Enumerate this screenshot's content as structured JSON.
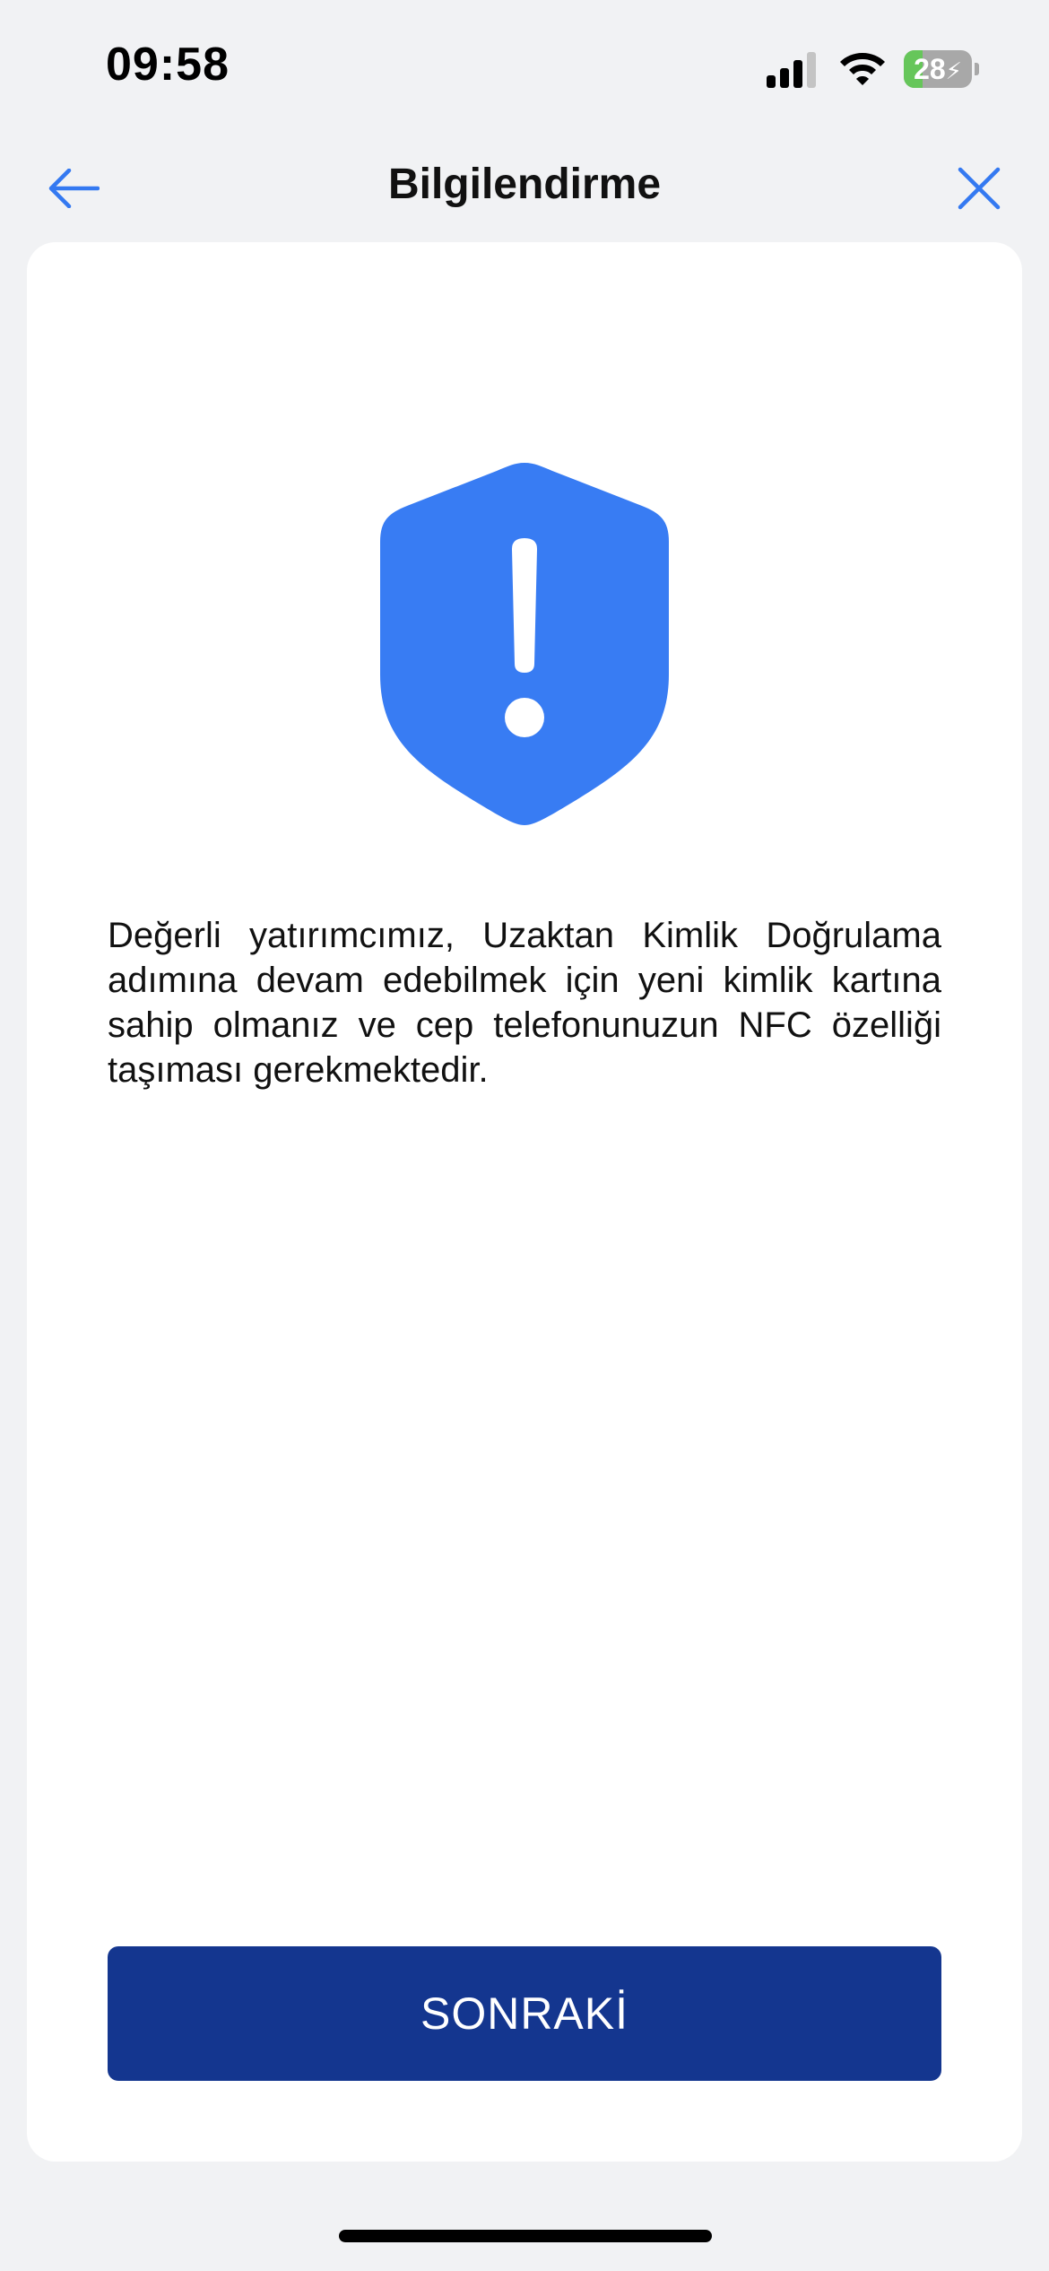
{
  "status_bar": {
    "time": "09:58",
    "battery_level": "28",
    "battery_percent": 28,
    "signal_bars": 3,
    "icons": [
      "signal-icon",
      "wifi-icon",
      "battery-charging-icon"
    ]
  },
  "nav": {
    "title": "Bilgilendirme",
    "back_icon": "arrow-left-icon",
    "close_icon": "close-icon",
    "accent_color": "#3479f1"
  },
  "content": {
    "icon": "shield-exclamation-icon",
    "icon_color": "#387cf3",
    "message": "Değerli yatırımcımız, Uzaktan Kimlik Doğrulama adımına devam edebilmek için yeni kimlik kartına sahip olmanız ve cep telefonunuzun NFC özelliği taşıması gerekmektedir."
  },
  "actions": {
    "next_label": "SONRAKİ",
    "next_color": "#14368f"
  }
}
